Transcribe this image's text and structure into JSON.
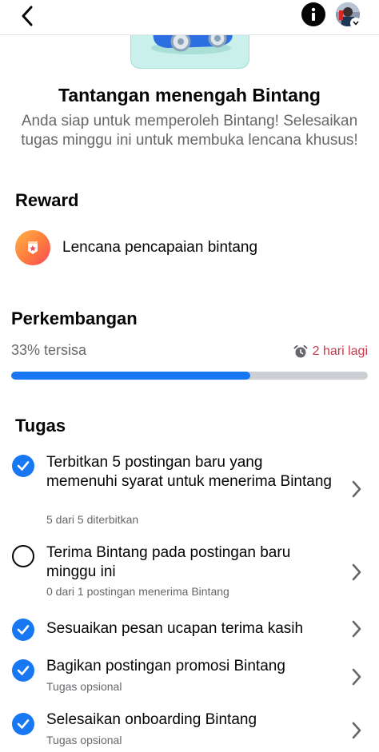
{
  "header": {
    "back_icon": "chevron-left-icon",
    "info_icon": "info-icon",
    "avatar_icon": "avatar"
  },
  "hero": {
    "title": "Tantangan menengah Bintang",
    "subtitle": "Anda siap untuk memperoleh Bintang! Selesaikan tugas minggu ini untuk membuka lencana khusus!"
  },
  "reward": {
    "heading": "Reward",
    "item_label": "Lencana pencapaian bintang",
    "icon": "badge-icon"
  },
  "progress": {
    "heading": "Perkembangan",
    "remaining_text": "33% tersisa",
    "time_left": "2 hari lagi",
    "time_icon": "alarm-clock-icon",
    "completed_fraction": 0.67
  },
  "tasks": {
    "heading": "Tugas",
    "items": [
      {
        "title": "Terbitkan 5 postingan baru yang memenuhi syarat untuk menerima Bintang",
        "subtitle": "5 dari 5 diterbitkan",
        "done": true
      },
      {
        "title": "Terima Bintang pada postingan baru minggu ini",
        "subtitle": "0 dari 1 postingan menerima Bintang",
        "done": false
      },
      {
        "title": "Sesuaikan pesan ucapan terima kasih",
        "subtitle": "",
        "done": true
      },
      {
        "title": "Bagikan postingan promosi Bintang",
        "subtitle": "Tugas opsional",
        "done": true
      },
      {
        "title": "Selesaikan onboarding Bintang",
        "subtitle": "Tugas opsional",
        "done": true
      }
    ]
  },
  "colors": {
    "accent": "#1877f2",
    "deadline": "#c9394a",
    "muted": "#65676b",
    "track": "#ccd0d5"
  }
}
